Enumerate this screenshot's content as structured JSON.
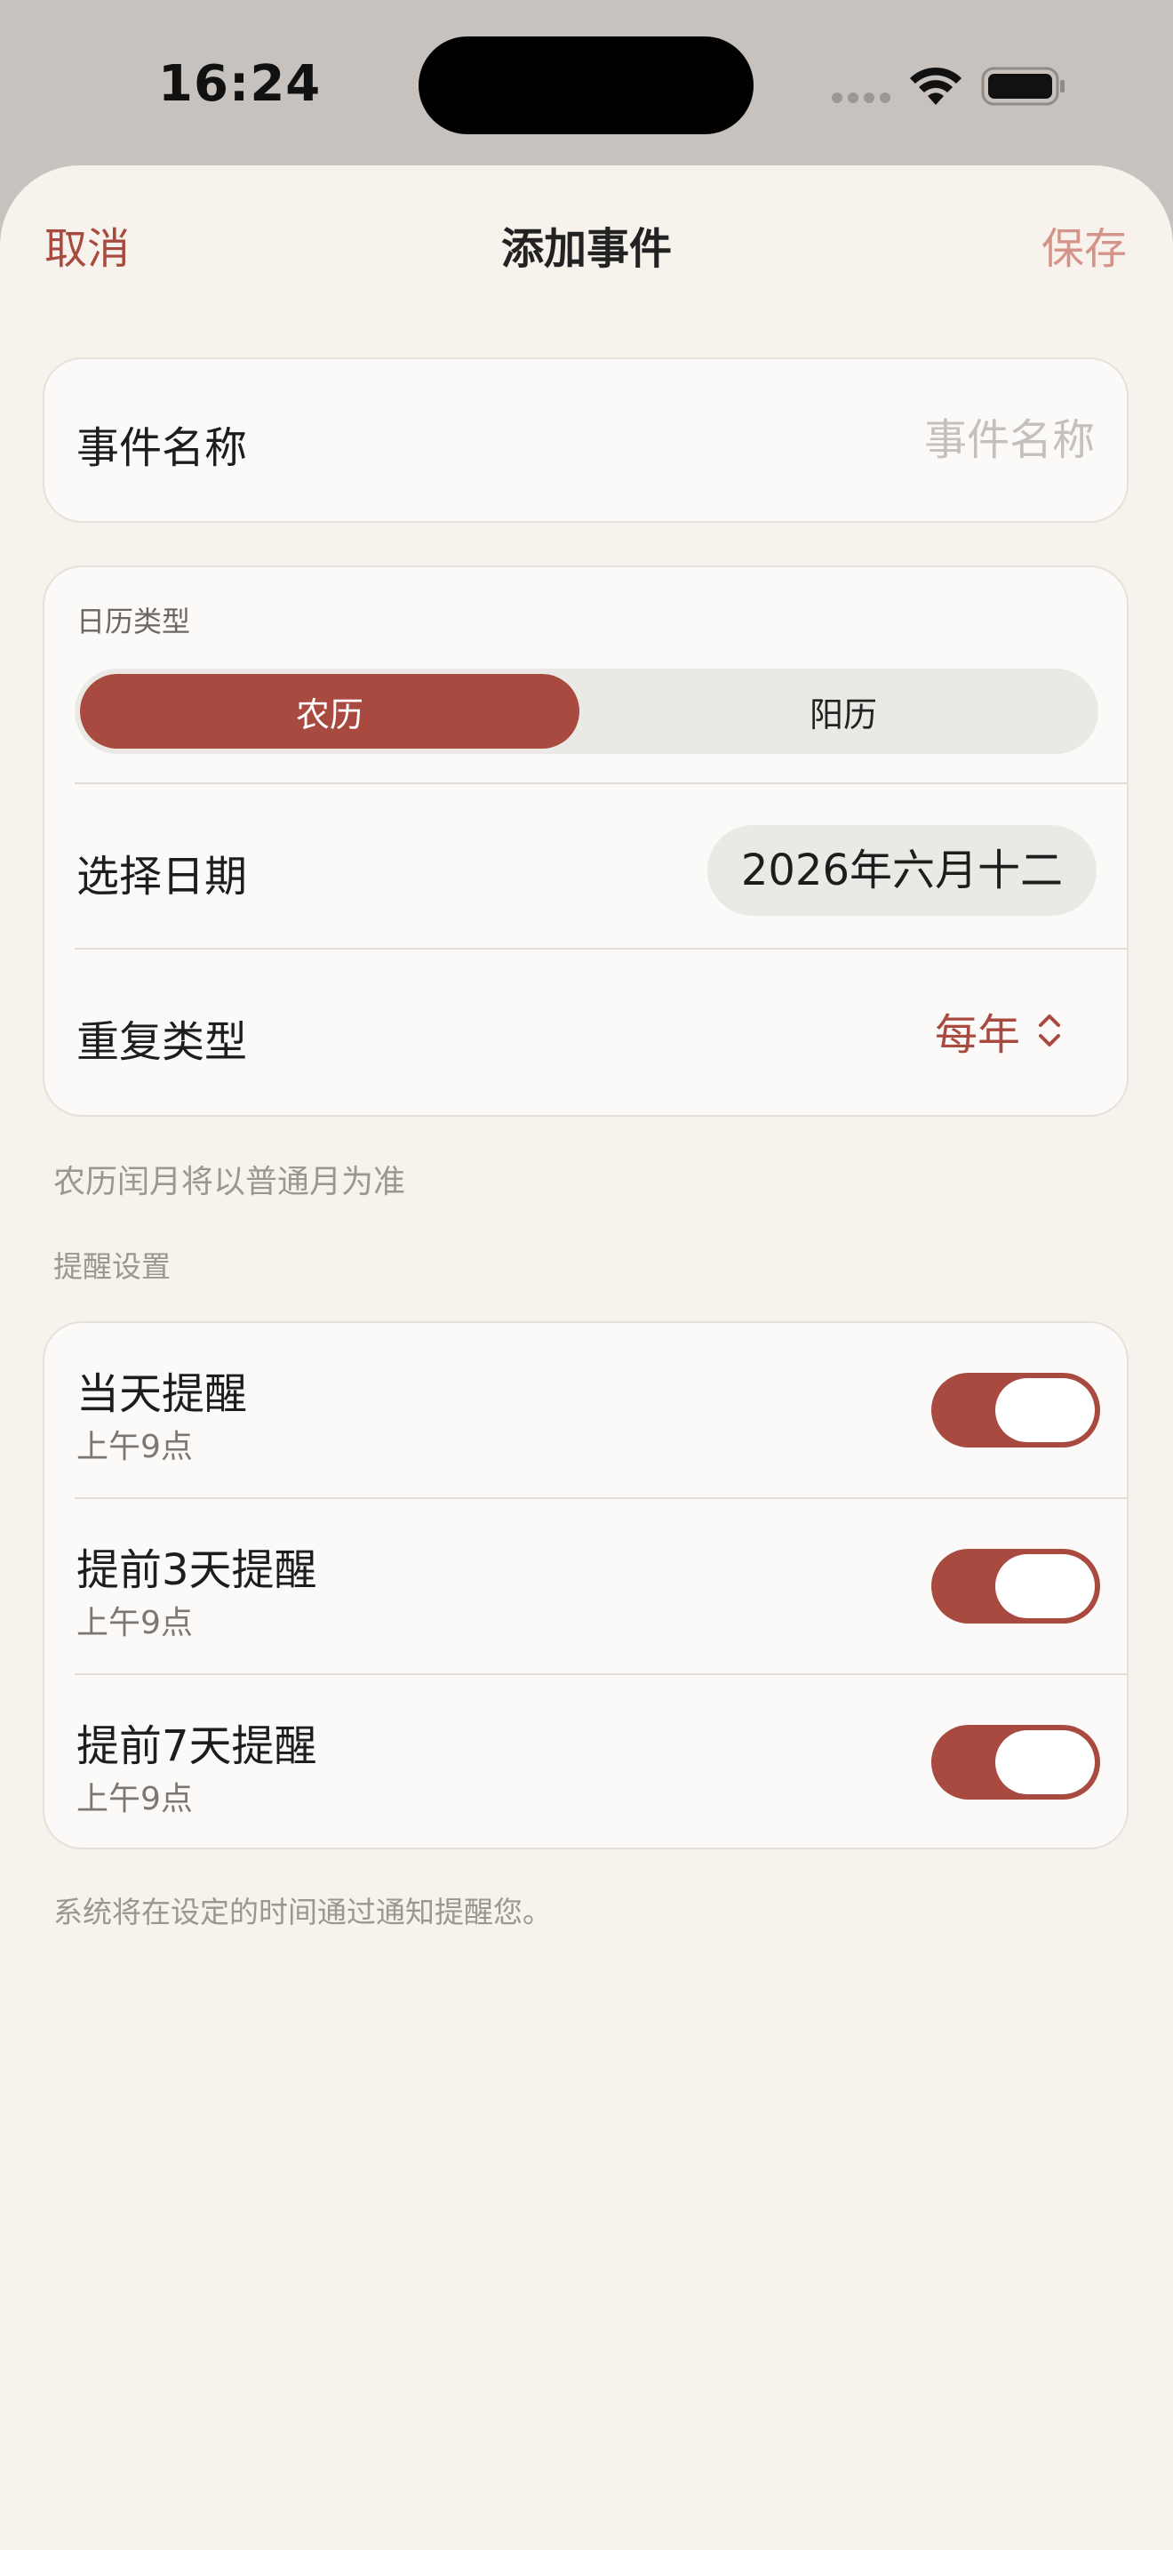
{
  "status_bar": {
    "time": "16:24"
  },
  "nav": {
    "cancel_label": "取消",
    "title": "添加事件",
    "save_label": "保存"
  },
  "event_name": {
    "label": "事件名称",
    "placeholder": "事件名称",
    "value": ""
  },
  "calendar": {
    "type_label": "日历类型",
    "options": [
      "农历",
      "阳历"
    ],
    "selected": "农历",
    "date_label": "选择日期",
    "date_value": "2026年六月十二",
    "repeat_label": "重复类型",
    "repeat_value": "每年"
  },
  "notes": {
    "leap_month": "农历闰月将以普通月为准",
    "system_notify": "系统将在设定的时间通过通知提醒您。"
  },
  "reminders": {
    "header": "提醒设置",
    "items": [
      {
        "title": "当天提醒",
        "subtitle": "上午9点",
        "enabled": true
      },
      {
        "title": "提前3天提醒",
        "subtitle": "上午9点",
        "enabled": true
      },
      {
        "title": "提前7天提醒",
        "subtitle": "上午9点",
        "enabled": true
      }
    ]
  },
  "colors": {
    "accent": "#a84a40",
    "save_disabled": "#d49489",
    "background": "#f7f2ec",
    "card": "#fcfaf8"
  }
}
